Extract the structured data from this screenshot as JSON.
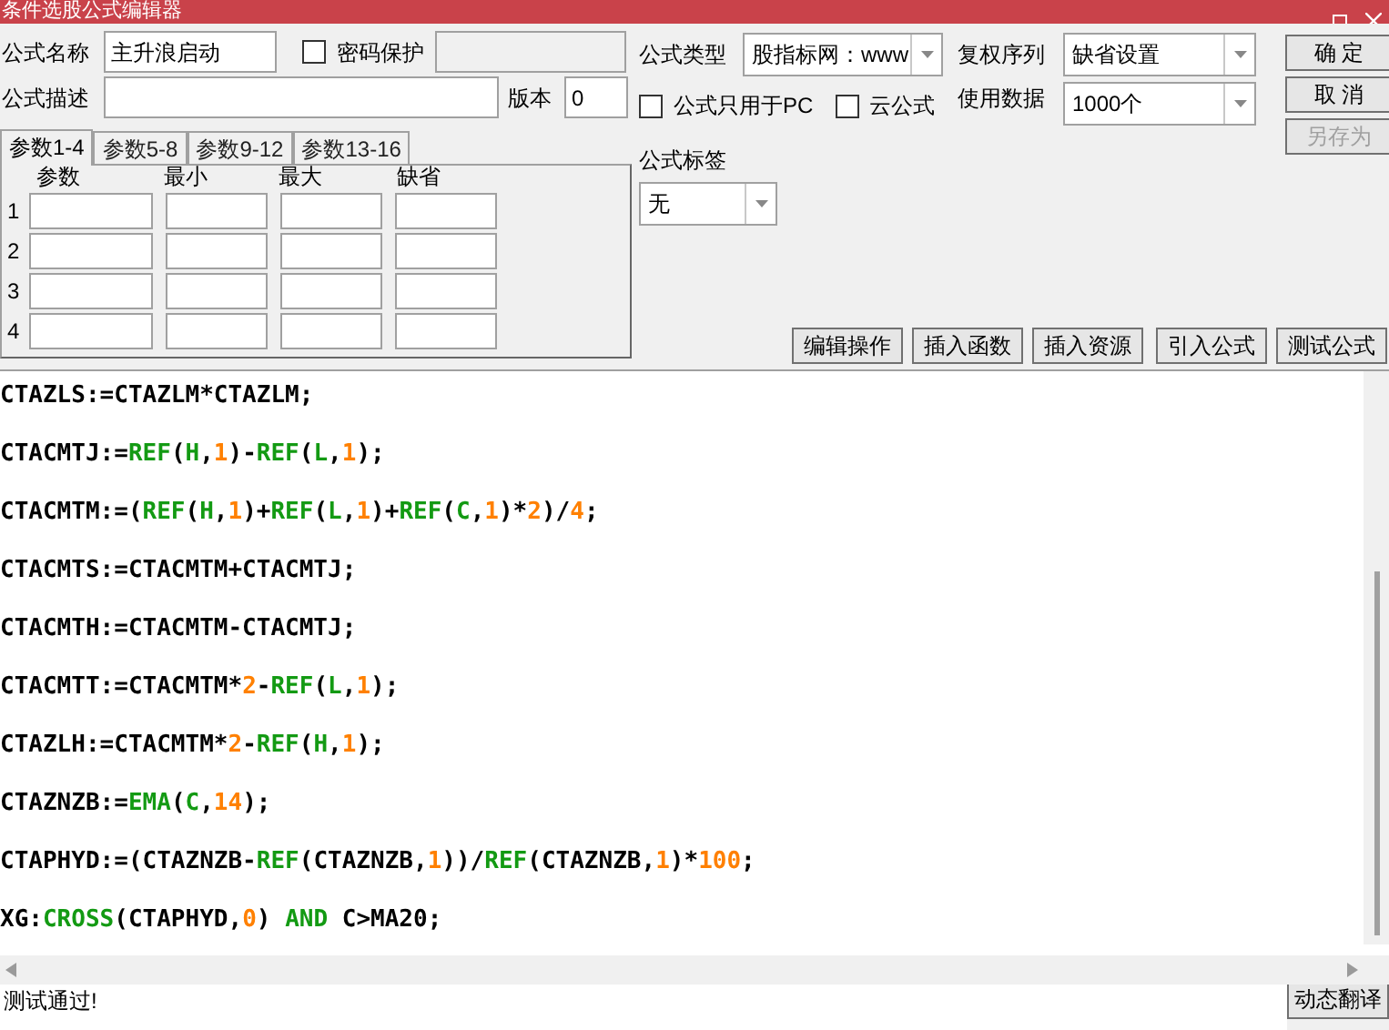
{
  "window": {
    "title": "条件选股公式编辑器"
  },
  "form": {
    "name_label": "公式名称",
    "name_value": "主升浪启动",
    "password": {
      "label": "密码保护",
      "checked": false
    },
    "desc_label": "公式描述",
    "version_label": "版本",
    "version_value": "0",
    "type_label": "公式类型",
    "type_value": "股指标网：www",
    "pc_only": {
      "label": "公式只用于PC",
      "checked": false
    },
    "cloud": {
      "label": "云公式",
      "checked": false
    },
    "adjust_label": "复权序列",
    "adjust_value": "缺省设置",
    "data_label": "使用数据",
    "data_value": "1000个",
    "tag_label": "公式标签",
    "tag_value": "无"
  },
  "actions": [
    {
      "label": "确 定",
      "disabled": false
    },
    {
      "label": "取 消",
      "disabled": false
    },
    {
      "label": "另存为",
      "disabled": true
    }
  ],
  "param_tabs": [
    {
      "label": "参数1-4",
      "selected": true
    },
    {
      "label": "参数5-8",
      "selected": false
    },
    {
      "label": "参数9-12",
      "selected": false
    },
    {
      "label": "参数13-16",
      "selected": false
    }
  ],
  "param_table": {
    "columns": [
      "参数",
      "最小",
      "最大",
      "缺省"
    ],
    "rows": [
      "1",
      "2",
      "3",
      "4"
    ]
  },
  "toolbar": [
    "编辑操作",
    "插入函数",
    "插入资源",
    "引入公式",
    "测试公式"
  ],
  "code_lines": [
    [
      {
        "text": "CTAZLS:=CTAZLM*CTAZLM;",
        "kind": "plain"
      }
    ],
    [
      {
        "text": "CTACMTJ:=",
        "kind": "plain"
      },
      {
        "text": "REF",
        "kind": "func"
      },
      {
        "text": "(",
        "kind": "plain"
      },
      {
        "text": "H",
        "kind": "func"
      },
      {
        "text": ",",
        "kind": "plain"
      },
      {
        "text": "1",
        "kind": "num"
      },
      {
        "text": ")-",
        "kind": "plain"
      },
      {
        "text": "REF",
        "kind": "func"
      },
      {
        "text": "(",
        "kind": "plain"
      },
      {
        "text": "L",
        "kind": "func"
      },
      {
        "text": ",",
        "kind": "plain"
      },
      {
        "text": "1",
        "kind": "num"
      },
      {
        "text": ");",
        "kind": "plain"
      }
    ],
    [
      {
        "text": "CTACMTM:=(",
        "kind": "plain"
      },
      {
        "text": "REF",
        "kind": "func"
      },
      {
        "text": "(",
        "kind": "plain"
      },
      {
        "text": "H",
        "kind": "func"
      },
      {
        "text": ",",
        "kind": "plain"
      },
      {
        "text": "1",
        "kind": "num"
      },
      {
        "text": ")+",
        "kind": "plain"
      },
      {
        "text": "REF",
        "kind": "func"
      },
      {
        "text": "(",
        "kind": "plain"
      },
      {
        "text": "L",
        "kind": "func"
      },
      {
        "text": ",",
        "kind": "plain"
      },
      {
        "text": "1",
        "kind": "num"
      },
      {
        "text": ")+",
        "kind": "plain"
      },
      {
        "text": "REF",
        "kind": "func"
      },
      {
        "text": "(",
        "kind": "plain"
      },
      {
        "text": "C",
        "kind": "func"
      },
      {
        "text": ",",
        "kind": "plain"
      },
      {
        "text": "1",
        "kind": "num"
      },
      {
        "text": ")*",
        "kind": "plain"
      },
      {
        "text": "2",
        "kind": "num"
      },
      {
        "text": ")/",
        "kind": "plain"
      },
      {
        "text": "4",
        "kind": "num"
      },
      {
        "text": ";",
        "kind": "plain"
      }
    ],
    [
      {
        "text": "CTACMTS:=CTACMTM+CTACMTJ;",
        "kind": "plain"
      }
    ],
    [
      {
        "text": "CTACMTH:=CTACMTM-CTACMTJ;",
        "kind": "plain"
      }
    ],
    [
      {
        "text": "CTACMTT:=CTACMTM*",
        "kind": "plain"
      },
      {
        "text": "2",
        "kind": "num"
      },
      {
        "text": "-",
        "kind": "plain"
      },
      {
        "text": "REF",
        "kind": "func"
      },
      {
        "text": "(",
        "kind": "plain"
      },
      {
        "text": "L",
        "kind": "func"
      },
      {
        "text": ",",
        "kind": "plain"
      },
      {
        "text": "1",
        "kind": "num"
      },
      {
        "text": ");",
        "kind": "plain"
      }
    ],
    [
      {
        "text": "CTAZLH:=CTACMTM*",
        "kind": "plain"
      },
      {
        "text": "2",
        "kind": "num"
      },
      {
        "text": "-",
        "kind": "plain"
      },
      {
        "text": "REF",
        "kind": "func"
      },
      {
        "text": "(",
        "kind": "plain"
      },
      {
        "text": "H",
        "kind": "func"
      },
      {
        "text": ",",
        "kind": "plain"
      },
      {
        "text": "1",
        "kind": "num"
      },
      {
        "text": ");",
        "kind": "plain"
      }
    ],
    [
      {
        "text": "CTAZNZB:=",
        "kind": "plain"
      },
      {
        "text": "EMA",
        "kind": "func"
      },
      {
        "text": "(",
        "kind": "plain"
      },
      {
        "text": "C",
        "kind": "func"
      },
      {
        "text": ",",
        "kind": "plain"
      },
      {
        "text": "14",
        "kind": "num"
      },
      {
        "text": ");",
        "kind": "plain"
      }
    ],
    [
      {
        "text": "CTAPHYD:=(CTAZNZB-",
        "kind": "plain"
      },
      {
        "text": "REF",
        "kind": "func"
      },
      {
        "text": "(CTAZNZB,",
        "kind": "plain"
      },
      {
        "text": "1",
        "kind": "num"
      },
      {
        "text": "))/",
        "kind": "plain"
      },
      {
        "text": "REF",
        "kind": "func"
      },
      {
        "text": "(CTAZNZB,",
        "kind": "plain"
      },
      {
        "text": "1",
        "kind": "num"
      },
      {
        "text": ")*",
        "kind": "plain"
      },
      {
        "text": "100",
        "kind": "num"
      },
      {
        "text": ";",
        "kind": "plain"
      }
    ],
    [
      {
        "text": "XG:",
        "kind": "plain"
      },
      {
        "text": "CROSS",
        "kind": "func"
      },
      {
        "text": "(CTAPHYD,",
        "kind": "plain"
      },
      {
        "text": "0",
        "kind": "num"
      },
      {
        "text": ") ",
        "kind": "plain"
      },
      {
        "text": "AND",
        "kind": "func"
      },
      {
        "text": " C>MA20;",
        "kind": "plain"
      }
    ]
  ],
  "status_bar": {
    "message": "测试通过!",
    "button": "动态翻译"
  }
}
